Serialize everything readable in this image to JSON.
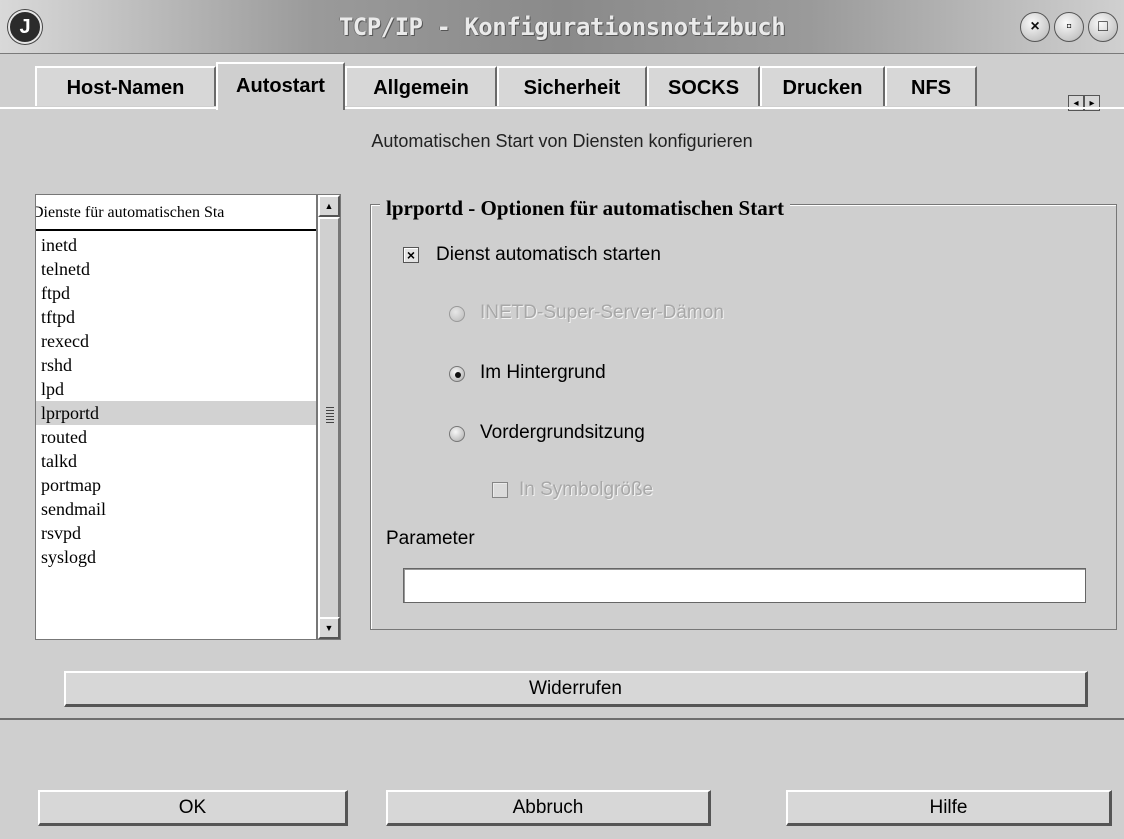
{
  "window": {
    "title": "TCP/IP - Konfigurationsnotizbuch",
    "sysmenu_glyph": "J",
    "buttons": {
      "close": "×",
      "minimize": "▫",
      "maximize": "□"
    }
  },
  "tabs": [
    "Host-Namen",
    "Autostart",
    "Allgemein",
    "Sicherheit",
    "SOCKS",
    "Drucken",
    "NFS"
  ],
  "active_tab": "Autostart",
  "tab_scroll": {
    "left": "◂",
    "right": "▸"
  },
  "heading": "Automatischen Start von Diensten konfigurieren",
  "services": {
    "header": "Dienste für automatischen Sta",
    "items": [
      "inetd",
      "telnetd",
      "ftpd",
      "tftpd",
      "rexecd",
      "rshd",
      "lpd",
      "lprportd",
      "routed",
      "talkd",
      "portmap",
      "sendmail",
      "rsvpd",
      "syslogd"
    ],
    "selected": "lprportd",
    "scroll_up": "▲",
    "scroll_down": "▼"
  },
  "options": {
    "legend": "lprportd - Optionen für automatischen Start",
    "auto_start": {
      "label": "Dienst automatisch starten",
      "checked": true,
      "mark": "×"
    },
    "radios": {
      "inetd": {
        "label": "INETD-Super-Server-Dämon",
        "disabled": true
      },
      "background": {
        "label": "Im Hintergrund",
        "checked": true
      },
      "foreground": {
        "label": "Vordergrundsitzung"
      }
    },
    "minimized": {
      "label": "In Symbolgröße",
      "disabled": true
    },
    "parameter_label": "Parameter",
    "parameter_value": ""
  },
  "buttons": {
    "undo": "Widerrufen",
    "ok": "OK",
    "cancel": "Abbruch",
    "help": "Hilfe"
  },
  "colors": {
    "background": "#cfcfcf",
    "selection": "#d2d2d2",
    "disabled_text": "#a8a8a8"
  }
}
